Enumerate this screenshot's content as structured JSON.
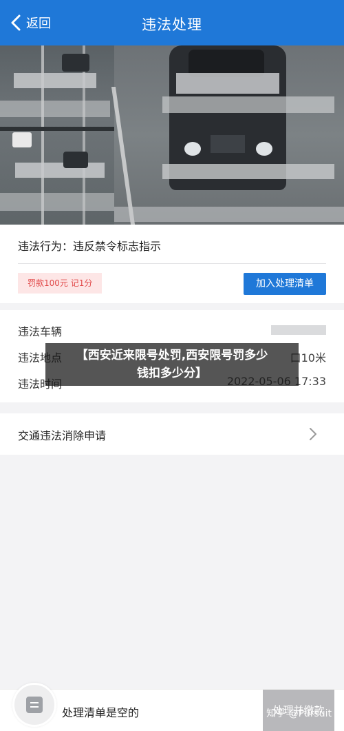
{
  "header": {
    "back_label": "返回",
    "title": "违法处理"
  },
  "violation": {
    "behavior": "违法行为：违反禁令标志指示",
    "fine": "罚款100元 记1分",
    "add_button": "加入处理清单"
  },
  "info": {
    "rows": [
      {
        "label": "违法车辆",
        "value": ""
      },
      {
        "label": "违法地点",
        "value": "口10米"
      },
      {
        "label": "违法时间",
        "value": "2022-05-06 17:33"
      }
    ]
  },
  "banner": {
    "line1": "【西安近来限号处罚,西安限号罚多少",
    "line2": "钱扣多少分】"
  },
  "appeal": {
    "label": "交通违法消除申请"
  },
  "bottom": {
    "empty_text": "处理清单是空的",
    "pay_button": "处理并缴款",
    "watermark": "知乎 @Pursuit"
  },
  "colors": {
    "primary": "#1f78d8",
    "fine_text": "#e14a4a",
    "fine_bg": "#fde6e6"
  }
}
